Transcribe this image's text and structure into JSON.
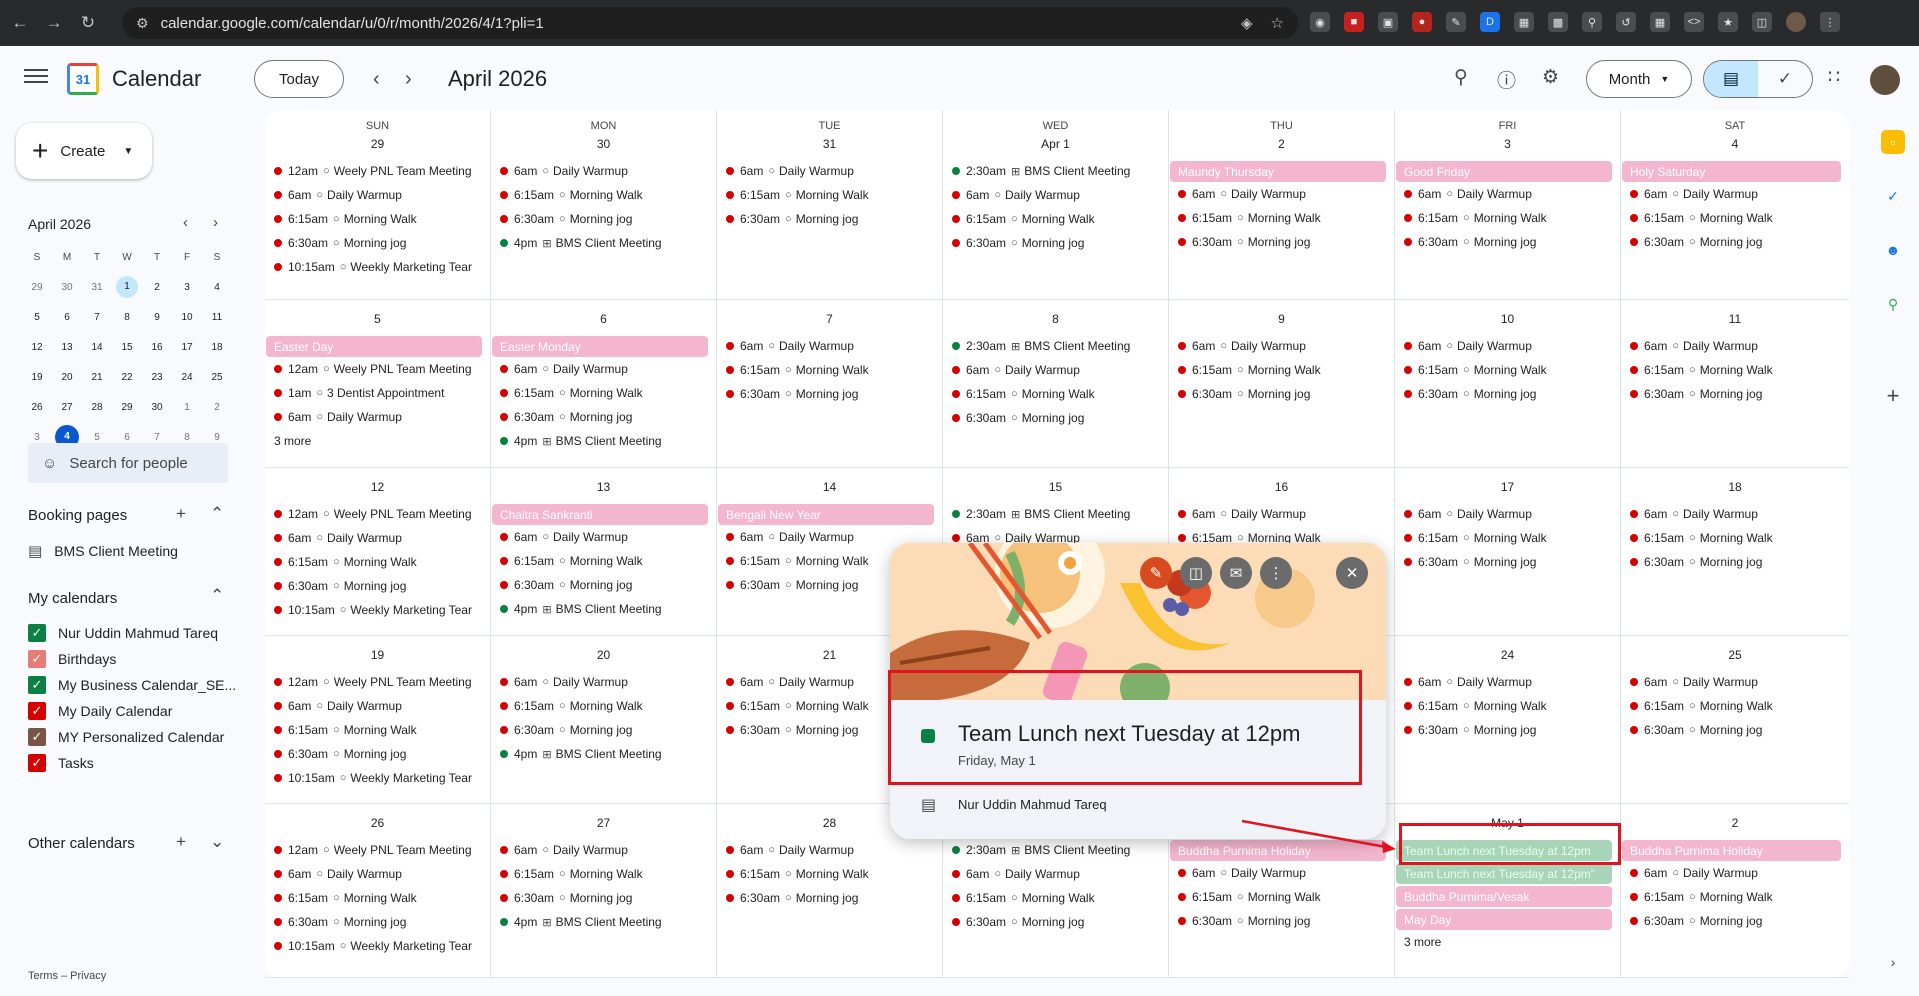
{
  "browser": {
    "url": "calendar.google.com/calendar/u/0/r/month/2026/4/1?pli=1"
  },
  "header": {
    "app_name": "Calendar",
    "logo_day": "31",
    "today_label": "Today",
    "month_title": "April 2026",
    "view_label": "Month"
  },
  "sidebar": {
    "create_label": "Create",
    "mini_title": "April 2026",
    "mini_days": [
      "S",
      "M",
      "T",
      "W",
      "T",
      "F",
      "S"
    ],
    "mini_weeks": [
      [
        "29",
        "30",
        "31",
        "1",
        "2",
        "3",
        "4"
      ],
      [
        "5",
        "6",
        "7",
        "8",
        "9",
        "10",
        "11"
      ],
      [
        "12",
        "13",
        "14",
        "15",
        "16",
        "17",
        "18"
      ],
      [
        "19",
        "20",
        "21",
        "22",
        "23",
        "24",
        "25"
      ],
      [
        "26",
        "27",
        "28",
        "29",
        "30",
        "1",
        "2"
      ],
      [
        "3",
        "4",
        "5",
        "6",
        "7",
        "8",
        "9"
      ]
    ],
    "search_people": "Search for people",
    "booking_title": "Booking pages",
    "booking_item": "BMS Client Meeting",
    "my_calendars_title": "My calendars",
    "my_calendars": [
      {
        "label": "Nur Uddin Mahmud Tareq",
        "color": "#0b8043"
      },
      {
        "label": "Birthdays",
        "color": "#e67c73"
      },
      {
        "label": "My Business Calendar_SE...",
        "color": "#0b8043"
      },
      {
        "label": "My Daily Calendar",
        "color": "#d50000"
      },
      {
        "label": "MY Personalized Calendar",
        "color": "#795548"
      },
      {
        "label": "Tasks",
        "color": "#d50000"
      }
    ],
    "other_calendars_title": "Other calendars",
    "footer": "Terms – Privacy"
  },
  "grid": {
    "weekdays": [
      "SUN",
      "MON",
      "TUE",
      "WED",
      "THU",
      "FRI",
      "SAT"
    ],
    "weeks": [
      [
        {
          "day": "29",
          "events": [
            [
              "d",
              "12am",
              "Weely PNL Team Meeting",
              "r"
            ],
            [
              "d",
              "6am",
              "Daily Warmup",
              "r"
            ],
            [
              "d",
              "6:15am",
              "Morning Walk",
              "r"
            ],
            [
              "d",
              "6:30am",
              "Morning jog",
              "r"
            ],
            [
              "d",
              "10:15am",
              "Weekly Marketing Tear",
              "r"
            ]
          ]
        },
        {
          "day": "30",
          "events": [
            [
              "d",
              "6am",
              "Daily Warmup",
              "r"
            ],
            [
              "d",
              "6:15am",
              "Morning Walk",
              "r"
            ],
            [
              "d",
              "6:30am",
              "Morning jog",
              "r"
            ],
            [
              "g",
              "4pm",
              "BMS Client Meeting",
              "g"
            ]
          ]
        },
        {
          "day": "31",
          "events": [
            [
              "d",
              "6am",
              "Daily Warmup",
              "r"
            ],
            [
              "d",
              "6:15am",
              "Morning Walk",
              "r"
            ],
            [
              "d",
              "6:30am",
              "Morning jog",
              "r"
            ]
          ]
        },
        {
          "day": "Apr 1",
          "events": [
            [
              "g",
              "2:30am",
              "BMS Client Meeting",
              "g"
            ],
            [
              "d",
              "6am",
              "Daily Warmup",
              "r"
            ],
            [
              "d",
              "6:15am",
              "Morning Walk",
              "r"
            ],
            [
              "d",
              "6:30am",
              "Morning jog",
              "r"
            ]
          ]
        },
        {
          "day": "2",
          "events": [
            [
              "c",
              "",
              "Maundy Thursday",
              ""
            ],
            [
              "d",
              "6am",
              "Daily Warmup",
              "r"
            ],
            [
              "d",
              "6:15am",
              "Morning Walk",
              "r"
            ],
            [
              "d",
              "6:30am",
              "Morning jog",
              "r"
            ]
          ]
        },
        {
          "day": "3",
          "events": [
            [
              "c",
              "",
              "Good Friday",
              ""
            ],
            [
              "d",
              "6am",
              "Daily Warmup",
              "r"
            ],
            [
              "d",
              "6:15am",
              "Morning Walk",
              "r"
            ],
            [
              "d",
              "6:30am",
              "Morning jog",
              "r"
            ]
          ]
        },
        {
          "day": "4",
          "events": [
            [
              "c",
              "",
              "Holy Saturday",
              ""
            ],
            [
              "d",
              "6am",
              "Daily Warmup",
              "r"
            ],
            [
              "d",
              "6:15am",
              "Morning Walk",
              "r"
            ],
            [
              "d",
              "6:30am",
              "Morning jog",
              "r"
            ]
          ]
        }
      ],
      [
        {
          "day": "5",
          "events": [
            [
              "c",
              "",
              "Easter Day",
              ""
            ],
            [
              "d",
              "12am",
              "Weely PNL Team Meeting",
              "r"
            ],
            [
              "d",
              "1am",
              "3 Dentist Appointment",
              "r"
            ],
            [
              "d",
              "6am",
              "Daily Warmup",
              "r"
            ]
          ],
          "more": "3 more"
        },
        {
          "day": "6",
          "events": [
            [
              "c",
              "",
              "Easter Monday",
              ""
            ],
            [
              "d",
              "6am",
              "Daily Warmup",
              "r"
            ],
            [
              "d",
              "6:15am",
              "Morning Walk",
              "r"
            ],
            [
              "d",
              "6:30am",
              "Morning jog",
              "r"
            ],
            [
              "g",
              "4pm",
              "BMS Client Meeting",
              "g"
            ]
          ]
        },
        {
          "day": "7",
          "events": [
            [
              "d",
              "6am",
              "Daily Warmup",
              "r"
            ],
            [
              "d",
              "6:15am",
              "Morning Walk",
              "r"
            ],
            [
              "d",
              "6:30am",
              "Morning jog",
              "r"
            ]
          ]
        },
        {
          "day": "8",
          "events": [
            [
              "g",
              "2:30am",
              "BMS Client Meeting",
              "g"
            ],
            [
              "d",
              "6am",
              "Daily Warmup",
              "r"
            ],
            [
              "d",
              "6:15am",
              "Morning Walk",
              "r"
            ],
            [
              "d",
              "6:30am",
              "Morning jog",
              "r"
            ]
          ]
        },
        {
          "day": "9",
          "events": [
            [
              "d",
              "6am",
              "Daily Warmup",
              "r"
            ],
            [
              "d",
              "6:15am",
              "Morning Walk",
              "r"
            ],
            [
              "d",
              "6:30am",
              "Morning jog",
              "r"
            ]
          ]
        },
        {
          "day": "10",
          "events": [
            [
              "d",
              "6am",
              "Daily Warmup",
              "r"
            ],
            [
              "d",
              "6:15am",
              "Morning Walk",
              "r"
            ],
            [
              "d",
              "6:30am",
              "Morning jog",
              "r"
            ]
          ]
        },
        {
          "day": "11",
          "events": [
            [
              "d",
              "6am",
              "Daily Warmup",
              "r"
            ],
            [
              "d",
              "6:15am",
              "Morning Walk",
              "r"
            ],
            [
              "d",
              "6:30am",
              "Morning jog",
              "r"
            ]
          ]
        }
      ],
      [
        {
          "day": "12",
          "events": [
            [
              "d",
              "12am",
              "Weely PNL Team Meeting",
              "r"
            ],
            [
              "d",
              "6am",
              "Daily Warmup",
              "r"
            ],
            [
              "d",
              "6:15am",
              "Morning Walk",
              "r"
            ],
            [
              "d",
              "6:30am",
              "Morning jog",
              "r"
            ],
            [
              "d",
              "10:15am",
              "Weekly Marketing Tear",
              "r"
            ]
          ]
        },
        {
          "day": "13",
          "events": [
            [
              "c",
              "",
              "Chaitra Sankranti",
              ""
            ],
            [
              "d",
              "6am",
              "Daily Warmup",
              "r"
            ],
            [
              "d",
              "6:15am",
              "Morning Walk",
              "r"
            ],
            [
              "d",
              "6:30am",
              "Morning jog",
              "r"
            ],
            [
              "g",
              "4pm",
              "BMS Client Meeting",
              "g"
            ]
          ]
        },
        {
          "day": "14",
          "events": [
            [
              "c",
              "",
              "Bengali New Year",
              ""
            ],
            [
              "d",
              "6am",
              "Daily Warmup",
              "r"
            ],
            [
              "d",
              "6:15am",
              "Morning Walk",
              "r"
            ],
            [
              "d",
              "6:30am",
              "Morning jog",
              "r"
            ]
          ]
        },
        {
          "day": "15",
          "events": [
            [
              "g",
              "2:30am",
              "BMS Client Meeting",
              "g"
            ],
            [
              "d",
              "6am",
              "Daily Warmup",
              "r"
            ]
          ]
        },
        {
          "day": "16",
          "events": [
            [
              "d",
              "6am",
              "Daily Warmup",
              "r"
            ],
            [
              "d",
              "6:15am",
              "Morning Walk",
              "r"
            ]
          ]
        },
        {
          "day": "17",
          "events": [
            [
              "d",
              "6am",
              "Daily Warmup",
              "r"
            ],
            [
              "d",
              "6:15am",
              "Morning Walk",
              "r"
            ],
            [
              "d",
              "6:30am",
              "Morning jog",
              "r"
            ]
          ]
        },
        {
          "day": "18",
          "events": [
            [
              "d",
              "6am",
              "Daily Warmup",
              "r"
            ],
            [
              "d",
              "6:15am",
              "Morning Walk",
              "r"
            ],
            [
              "d",
              "6:30am",
              "Morning jog",
              "r"
            ]
          ]
        }
      ],
      [
        {
          "day": "19",
          "events": [
            [
              "d",
              "12am",
              "Weely PNL Team Meeting",
              "r"
            ],
            [
              "d",
              "6am",
              "Daily Warmup",
              "r"
            ],
            [
              "d",
              "6:15am",
              "Morning Walk",
              "r"
            ],
            [
              "d",
              "6:30am",
              "Morning jog",
              "r"
            ],
            [
              "d",
              "10:15am",
              "Weekly Marketing Tear",
              "r"
            ]
          ]
        },
        {
          "day": "20",
          "events": [
            [
              "d",
              "6am",
              "Daily Warmup",
              "r"
            ],
            [
              "d",
              "6:15am",
              "Morning Walk",
              "r"
            ],
            [
              "d",
              "6:30am",
              "Morning jog",
              "r"
            ],
            [
              "g",
              "4pm",
              "BMS Client Meeting",
              "g"
            ]
          ]
        },
        {
          "day": "21",
          "events": [
            [
              "d",
              "6am",
              "Daily Warmup",
              "r"
            ],
            [
              "d",
              "6:15am",
              "Morning Walk",
              "r"
            ],
            [
              "d",
              "6:30am",
              "Morning jog",
              "r"
            ]
          ]
        },
        {
          "day": "",
          "events": []
        },
        {
          "day": "",
          "events": []
        },
        {
          "day": "24",
          "events": [
            [
              "d",
              "6am",
              "Daily Warmup",
              "r"
            ],
            [
              "d",
              "6:15am",
              "Morning Walk",
              "r"
            ],
            [
              "d",
              "6:30am",
              "Morning jog",
              "r"
            ]
          ]
        },
        {
          "day": "25",
          "events": [
            [
              "d",
              "6am",
              "Daily Warmup",
              "r"
            ],
            [
              "d",
              "6:15am",
              "Morning Walk",
              "r"
            ],
            [
              "d",
              "6:30am",
              "Morning jog",
              "r"
            ]
          ]
        }
      ],
      [
        {
          "day": "26",
          "events": [
            [
              "d",
              "12am",
              "Weely PNL Team Meeting",
              "r"
            ],
            [
              "d",
              "6am",
              "Daily Warmup",
              "r"
            ],
            [
              "d",
              "6:15am",
              "Morning Walk",
              "r"
            ],
            [
              "d",
              "6:30am",
              "Morning jog",
              "r"
            ],
            [
              "d",
              "10:15am",
              "Weekly Marketing Tear",
              "r"
            ]
          ]
        },
        {
          "day": "27",
          "events": [
            [
              "d",
              "6am",
              "Daily Warmup",
              "r"
            ],
            [
              "d",
              "6:15am",
              "Morning Walk",
              "r"
            ],
            [
              "d",
              "6:30am",
              "Morning jog",
              "r"
            ],
            [
              "g",
              "4pm",
              "BMS Client Meeting",
              "g"
            ]
          ]
        },
        {
          "day": "28",
          "events": [
            [
              "d",
              "6am",
              "Daily Warmup",
              "r"
            ],
            [
              "d",
              "6:15am",
              "Morning Walk",
              "r"
            ],
            [
              "d",
              "6:30am",
              "Morning jog",
              "r"
            ]
          ]
        },
        {
          "day": "",
          "events": [
            [
              "g",
              "2:30am",
              "BMS Client Meeting",
              "g"
            ],
            [
              "d",
              "6am",
              "Daily Warmup",
              "r"
            ],
            [
              "d",
              "6:15am",
              "Morning Walk",
              "r"
            ],
            [
              "d",
              "6:30am",
              "Morning jog",
              "r"
            ]
          ]
        },
        {
          "day": "",
          "events": [
            [
              "c",
              "",
              "Buddha Purnima Holiday",
              ""
            ],
            [
              "d",
              "6am",
              "Daily Warmup",
              "r"
            ],
            [
              "d",
              "6:15am",
              "Morning Walk",
              "r"
            ],
            [
              "d",
              "6:30am",
              "Morning jog",
              "r"
            ]
          ]
        },
        {
          "day": "May 1",
          "events": [
            [
              "cg",
              "",
              "Team Lunch next Tuesday at 12pm",
              ""
            ],
            [
              "cg",
              "",
              "Team Lunch next Tuesday at 12pm\"",
              ""
            ],
            [
              "c",
              "",
              "Buddha Purnima/Vesak",
              ""
            ],
            [
              "c",
              "",
              "May Day",
              ""
            ]
          ],
          "more": "3 more"
        },
        {
          "day": "2",
          "events": [
            [
              "c",
              "",
              "Buddha Purnima Holiday",
              ""
            ],
            [
              "d",
              "6am",
              "Daily Warmup",
              "r"
            ],
            [
              "d",
              "6:15am",
              "Morning Walk",
              "r"
            ],
            [
              "d",
              "6:30am",
              "Morning jog",
              "r"
            ]
          ]
        }
      ]
    ]
  },
  "popup": {
    "title": "Team Lunch next Tuesday at 12pm",
    "date": "Friday, May 1",
    "calendar": "Nur Uddin Mahmud Tareq",
    "color": "#0b8043"
  },
  "colors": {
    "red": "#d50000",
    "green": "#0b8043",
    "holiday_chip": "#f4b6cf",
    "annotation": "#e0141e"
  }
}
